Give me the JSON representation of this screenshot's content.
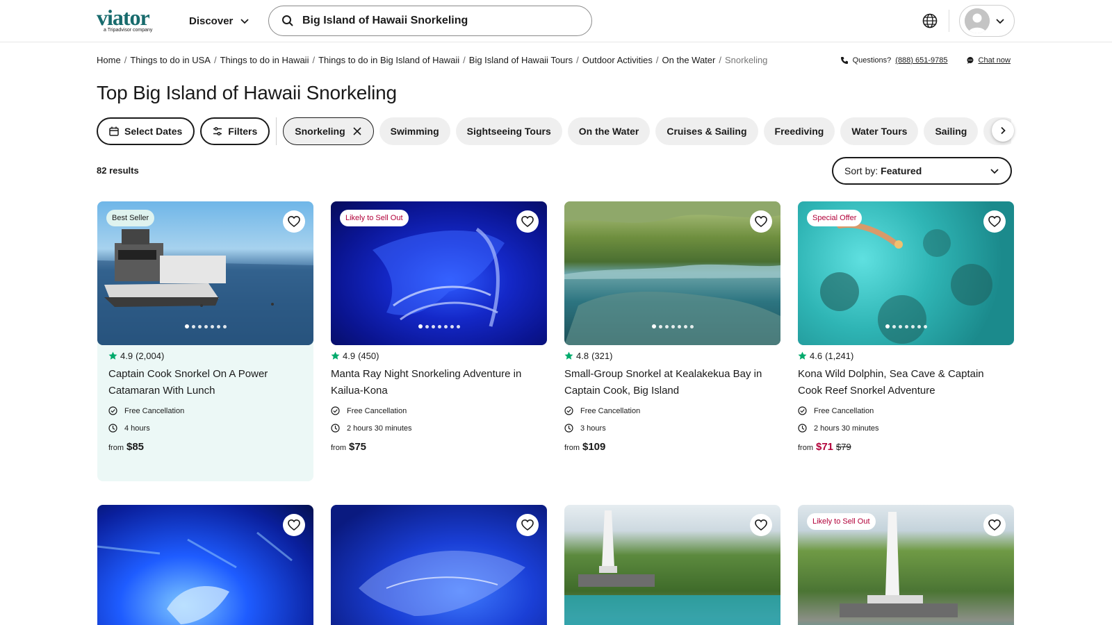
{
  "header": {
    "logo_text": "viator",
    "logo_tagline": "a Tripadvisor company",
    "discover_label": "Discover",
    "search_value": "Big Island of Hawaii Snorkeling"
  },
  "breadcrumb": {
    "items": [
      "Home",
      "Things to do in USA",
      "Things to do in Hawaii",
      "Things to do in Big Island of Hawaii",
      "Big Island of Hawaii Tours",
      "Outdoor Activities",
      "On the Water"
    ],
    "current": "Snorkeling",
    "separator": "/"
  },
  "contact": {
    "questions_label": "Questions?",
    "phone": "(888) 651-9785",
    "chat_label": "Chat now"
  },
  "page_title": "Top Big Island of Hawaii Snorkeling",
  "filters": {
    "select_dates": "Select Dates",
    "filters_label": "Filters",
    "active_chip": "Snorkeling",
    "chips": [
      "Swimming",
      "Sightseeing Tours",
      "On the Water",
      "Cruises & Sailing",
      "Freediving",
      "Water Tours",
      "Sailing",
      "Ha"
    ]
  },
  "results": {
    "count": "82 results",
    "sort_prefix": "Sort by:",
    "sort_value": "Featured"
  },
  "cards": [
    {
      "badge": "Best Seller",
      "rating": "4.9",
      "reviews": "(2,004)",
      "title": "Captain Cook Snorkel On A Power Catamaran With Lunch",
      "cancellation": "Free Cancellation",
      "duration": "4 hours",
      "from_label": "from",
      "price": "$85",
      "old_price": ""
    },
    {
      "badge": "Likely to Sell Out",
      "rating": "4.9",
      "reviews": "(450)",
      "title": "Manta Ray Night Snorkeling Adventure in Kailua-Kona",
      "cancellation": "Free Cancellation",
      "duration": "2 hours 30 minutes",
      "from_label": "from",
      "price": "$75",
      "old_price": ""
    },
    {
      "badge": "",
      "rating": "4.8",
      "reviews": "(321)",
      "title": "Small-Group Snorkel at Kealakekua Bay in Captain Cook, Big Island",
      "cancellation": "Free Cancellation",
      "duration": "3 hours",
      "from_label": "from",
      "price": "$109",
      "old_price": ""
    },
    {
      "badge": "Special Offer",
      "rating": "4.6",
      "reviews": "(1,241)",
      "title": "Kona Wild Dolphin, Sea Cave & Captain Cook Reef Snorkel Adventure",
      "cancellation": "Free Cancellation",
      "duration": "2 hours 30 minutes",
      "from_label": "from",
      "price": "$71",
      "old_price": "$79"
    },
    {
      "badge": ""
    },
    {
      "badge": ""
    },
    {
      "badge": ""
    },
    {
      "badge": "Likely to Sell Out"
    }
  ],
  "colors": {
    "brand": "#186b6d",
    "star": "#00aa6c",
    "sale": "#b20039",
    "highlight_card": "#ecf8f6"
  }
}
